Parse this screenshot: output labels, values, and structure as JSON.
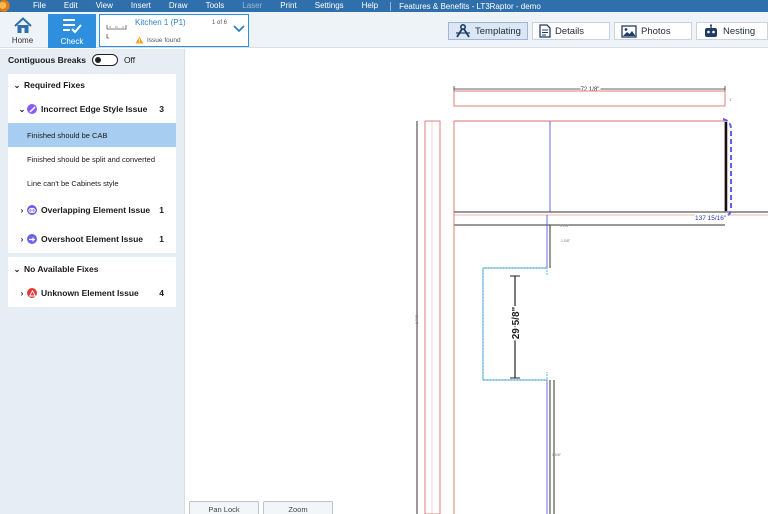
{
  "menu": {
    "items": [
      "File",
      "Edit",
      "View",
      "Insert",
      "Draw",
      "Tools",
      "Laser",
      "Print",
      "Settings",
      "Help"
    ],
    "disabled": [
      "Laser"
    ],
    "window_title": "Features & Benefits - LT3Raptor - demo"
  },
  "toolbar": {
    "home_label": "Home",
    "check_label": "Check",
    "drawing_name": "Kitchen 1 (P1)",
    "page_count": "1 of 6",
    "issue_text": "Issue found",
    "tabs": [
      "Templating",
      "Details",
      "Photos",
      "Nesting"
    ],
    "active_tab": "Templating"
  },
  "sidebar": {
    "contiguous_label": "Contiguous Breaks",
    "contiguous_state": "Off",
    "groups": [
      {
        "title": "Required Fixes",
        "issues": [
          {
            "title": "Incorrect Edge Style Issue",
            "count": "3",
            "icon": "edge-style-icon",
            "color": "#8a5cf6",
            "expanded": true,
            "fixes": [
              "Finished should be CAB",
              "Finished should be split and converted",
              "Line can't be Cabinets style"
            ],
            "selected_fix": 0
          },
          {
            "title": "Overlapping Element Issue",
            "count": "1",
            "icon": "overlap-icon",
            "color": "#6b63e6"
          },
          {
            "title": "Overshoot Element Issue",
            "count": "1",
            "icon": "overshoot-icon",
            "color": "#6b63e6"
          }
        ]
      },
      {
        "title": "No Available Fixes",
        "issues": [
          {
            "title": "Unknown Element Issue",
            "count": "4",
            "icon": "warning-triangle-icon",
            "color": "#e03a3a"
          }
        ]
      }
    ]
  },
  "canvas": {
    "dimensions": [
      "72 1/8\"",
      "137 15/16\"",
      "29 5/8\""
    ],
    "buttons": [
      "Pan Lock",
      "Zoom"
    ],
    "colors": {
      "outline": "#e07070",
      "edge": "#5560e0",
      "cutout": "#3cc0c0",
      "selection": "#6a5cf0"
    }
  }
}
